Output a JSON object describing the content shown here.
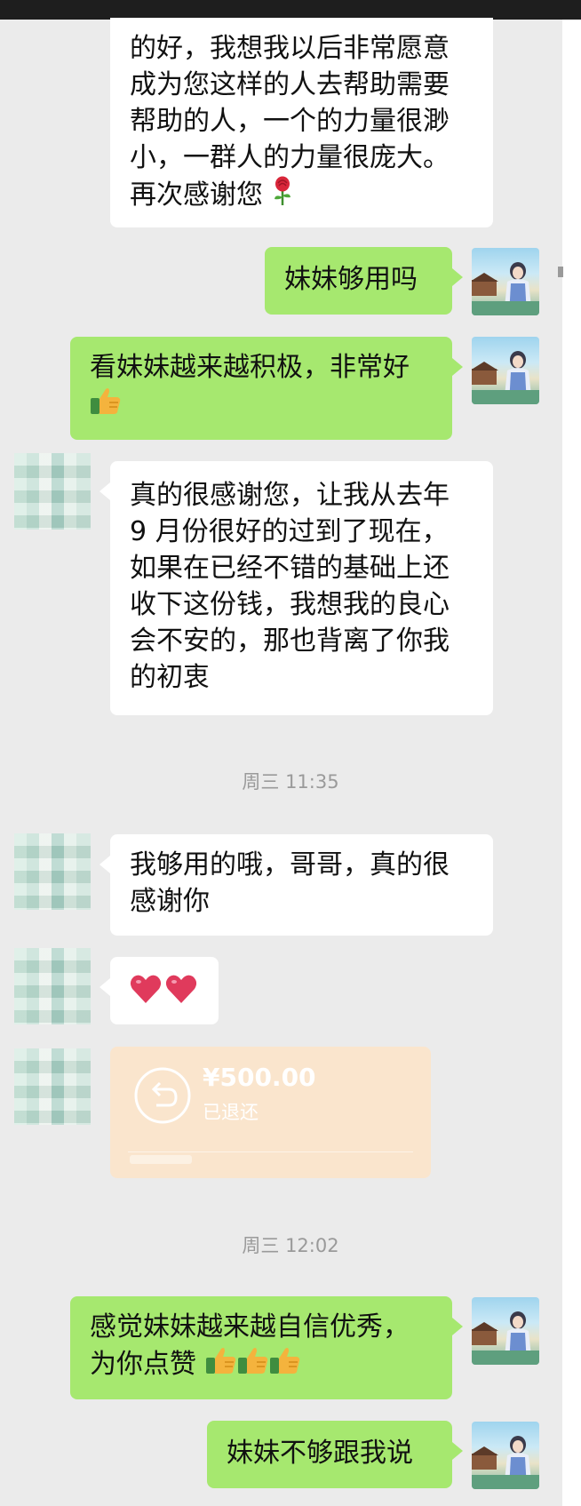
{
  "messages": [
    {
      "lines": [
        "的好，我想我以后非常愿意",
        "成为您这样的人去帮助需要",
        "帮助的人，一个的力量很渺",
        "小，一群人的力量很庞大。",
        "再次感谢您"
      ],
      "emoji": "rose"
    },
    {
      "lines": [
        "妹妹够用吗"
      ]
    },
    {
      "lines": [
        "看妹妹越来越积极，非常好"
      ],
      "emoji": "thumbs-up"
    },
    {
      "lines": [
        "真的很感谢您，让我从去年",
        "9 月份很好的过到了现在，",
        "如果在已经不错的基础上还",
        "收下这份钱，我想我的良心",
        "会不安的，那也背离了你我",
        "的初衷"
      ]
    },
    {
      "lines": [
        "我够用的哦，哥哥，真的很",
        "感谢你"
      ]
    },
    {
      "emoji": "two-hearts"
    },
    {
      "lines": [
        "感觉妹妹越来越自信优秀，",
        "为你点赞"
      ],
      "emoji": "thumbs-up x3"
    },
    {
      "lines": [
        "妹妹不够跟我说"
      ]
    }
  ],
  "timestamps": [
    "周三 11:35",
    "周三 12:02"
  ],
  "transfer": {
    "amount": "¥500.00",
    "status": "已退还",
    "icon": "return-icon"
  },
  "colors": {
    "outgoing_bubble": "#a6e86f",
    "incoming_bubble": "#ffffff",
    "transfer_card": "#fae5cd",
    "background": "#ebebeb"
  }
}
